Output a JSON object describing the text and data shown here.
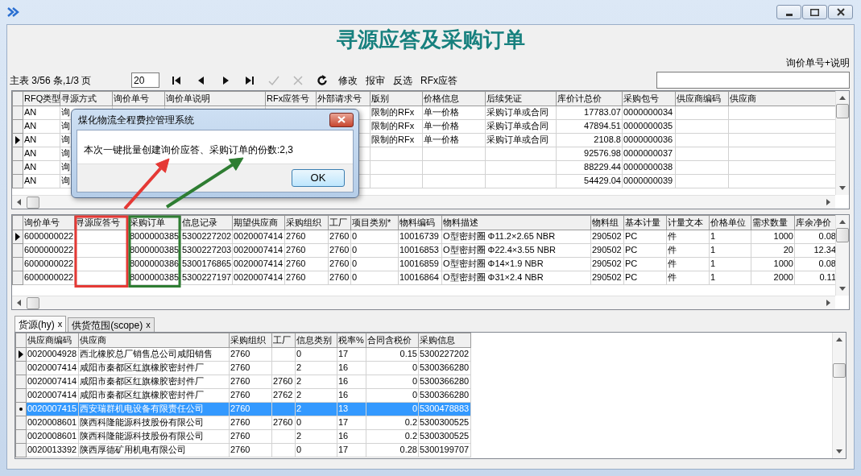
{
  "window": {
    "controls": [
      {
        "kind": "minimize"
      },
      {
        "kind": "maximize"
      },
      {
        "kind": "close"
      }
    ]
  },
  "title": "寻源应答及采购订单",
  "search": {
    "label": "询价单号+说明"
  },
  "toolbar": {
    "summary": "主表 3/56 条,1/3 页",
    "page_size": "20",
    "items": [
      {
        "kind": "first",
        "disabled": false
      },
      {
        "kind": "prev",
        "disabled": false
      },
      {
        "kind": "next",
        "disabled": false
      },
      {
        "kind": "last",
        "disabled": false
      },
      {
        "kind": "confirm",
        "disabled": true
      },
      {
        "kind": "cancel",
        "disabled": true
      },
      {
        "kind": "refresh",
        "disabled": false
      },
      {
        "kind": "text",
        "label": "修改",
        "disabled": false
      },
      {
        "kind": "text",
        "label": "报审",
        "disabled": false
      },
      {
        "kind": "text",
        "label": "反选",
        "disabled": false
      },
      {
        "kind": "text",
        "label": "RFx应答",
        "disabled": false
      }
    ]
  },
  "master_grid": {
    "columns": [
      "RFQ类型",
      "寻源方式",
      "询价单号",
      "询价单说明",
      "RFx应答号",
      "外部请求号",
      "版别",
      "价格信息",
      "后续凭证",
      "库价计总价",
      "采购包号",
      "供应商编码",
      "供应商"
    ],
    "rows": [
      {
        "current": false,
        "selected": false,
        "cells": [
          "AN",
          "询",
          null,
          null,
          null,
          null,
          "限制的RFx",
          "单一价格",
          "采购订单或合同",
          "17783.07",
          "0000000034",
          null,
          null
        ]
      },
      {
        "current": false,
        "selected": false,
        "cells": [
          "AN",
          "询",
          null,
          null,
          null,
          null,
          "限制的RFx",
          "单一价格",
          "采购订单或合同",
          "47894.51",
          "0000000035",
          null,
          null
        ]
      },
      {
        "current": true,
        "selected": false,
        "cells": [
          "AN",
          "询",
          null,
          null,
          null,
          null,
          "限制的RFx",
          "单一价格",
          "采购订单或合同",
          "2108.8",
          "0000000036",
          null,
          null
        ]
      },
      {
        "current": false,
        "selected": false,
        "cells": [
          "AN",
          "询",
          null,
          null,
          null,
          null,
          null,
          null,
          null,
          "92576.98",
          "0000000037",
          null,
          null
        ]
      },
      {
        "current": false,
        "selected": false,
        "cells": [
          "AN",
          "询",
          null,
          null,
          null,
          null,
          null,
          null,
          null,
          "88229.44",
          "0000000038",
          null,
          null
        ]
      },
      {
        "current": false,
        "selected": false,
        "cells": [
          "AN",
          "询",
          null,
          null,
          null,
          null,
          null,
          null,
          null,
          "54429.04",
          "0000000039",
          null,
          null
        ]
      }
    ]
  },
  "dialog": {
    "title": "煤化物流全程费控管理系统",
    "message": "本次一键批量创建询价应答、采购订单的份数:2,3",
    "button": "OK"
  },
  "detail_grid": {
    "columns": [
      "询价单号",
      "寻源应答号",
      "采购订单",
      "信息记录",
      "期望供应商",
      "采购组织",
      "工厂",
      "项目类别*",
      "物料编码",
      "物料描述",
      "物料组",
      "基本计量",
      "计量文本",
      "价格单位",
      "需求数量",
      "库余净价"
    ],
    "rows": [
      {
        "current": true,
        "selected": false,
        "cells": [
          "6000000022",
          null,
          "8000000385",
          "5300227202",
          "0020007414",
          "2760",
          "2760",
          "0",
          "10016739",
          "O型密封圈 Φ11.2×2.65 NBR",
          "290502",
          "PC",
          "件",
          "1",
          "1000",
          "0.08"
        ]
      },
      {
        "current": false,
        "selected": false,
        "cells": [
          "6000000022",
          null,
          "8000000385",
          "5300227203",
          "0020007414",
          "2760",
          "2760",
          "0",
          "10016853",
          "O型密封圈 Φ22.4×3.55 NBR",
          "290502",
          "PC",
          "件",
          "1",
          "20",
          "12.34"
        ]
      },
      {
        "current": false,
        "selected": false,
        "cells": [
          "6000000022",
          null,
          "8000000386",
          "5300176865",
          "0020007414",
          "2760",
          "2760",
          "0",
          "10016859",
          "O型密封圈 Φ14×1.9 NBR",
          "290502",
          "PC",
          "件",
          "1",
          "1000",
          "0.08"
        ]
      },
      {
        "current": false,
        "selected": false,
        "cells": [
          "6000000022",
          null,
          "8000000385",
          "5300227197",
          "0020007414",
          "2760",
          "2760",
          "0",
          "10016864",
          "O型密封圈 Φ31×2.4 NBR",
          "290502",
          "PC",
          "件",
          "1",
          "2000",
          "0.11"
        ]
      }
    ]
  },
  "tabs": [
    {
      "label": "货源(hy)",
      "close": "x",
      "selected": true
    },
    {
      "label": "供货范围(scope)",
      "close": "x",
      "selected": false
    }
  ],
  "source_grid": {
    "columns": [
      "供应商编码",
      "供应商",
      "采购组织",
      "工厂",
      "信息类别",
      "税率%",
      "合同含税价",
      "采购信息"
    ],
    "rows": [
      {
        "current": true,
        "selected": false,
        "cells": [
          "0020004928",
          "西北橡胶总厂销售总公司咸阳销售",
          "2760",
          null,
          "0",
          "17",
          "0.15",
          "5300227202"
        ]
      },
      {
        "current": false,
        "selected": false,
        "cells": [
          "0020007414",
          "咸阳市秦都区红旗橡胶密封件厂",
          "2760",
          null,
          "2",
          "16",
          "0",
          "5300366280"
        ]
      },
      {
        "current": false,
        "selected": false,
        "cells": [
          "0020007414",
          "咸阳市秦都区红旗橡胶密封件厂",
          "2760",
          "2760",
          "2",
          "16",
          "0",
          "5300366280"
        ]
      },
      {
        "current": false,
        "selected": false,
        "cells": [
          "0020007414",
          "咸阳市秦都区红旗橡胶密封件厂",
          "2760",
          "2762",
          "2",
          "16",
          "0",
          "5300366280"
        ]
      },
      {
        "current": false,
        "selected": true,
        "cells": [
          "0020007415",
          "西安瑞群机电设备有限责任公司",
          "2760",
          null,
          "2",
          "13",
          "0",
          "5300478883"
        ]
      },
      {
        "current": false,
        "selected": false,
        "cells": [
          "0020008601",
          "陕西科隆能源科技股份有限公司",
          "2760",
          "2760",
          "0",
          "17",
          "0.2",
          "5300300525"
        ]
      },
      {
        "current": false,
        "selected": false,
        "cells": [
          "0020008601",
          "陕西科隆能源科技股份有限公司",
          "2760",
          null,
          "2",
          "16",
          "0.2",
          "5300300525"
        ]
      },
      {
        "current": false,
        "selected": false,
        "cells": [
          "0020013392",
          "陕西厚德矿用机电有限公司",
          "2760",
          null,
          "0",
          "17",
          "0.28",
          "5300199707"
        ]
      }
    ]
  },
  "annotations": {
    "boxes": [
      {
        "color": "#e53935"
      },
      {
        "color": "#2e7d32"
      }
    ],
    "arrows": [
      {
        "color": "#e53935"
      },
      {
        "color": "#2e7d32"
      }
    ]
  }
}
